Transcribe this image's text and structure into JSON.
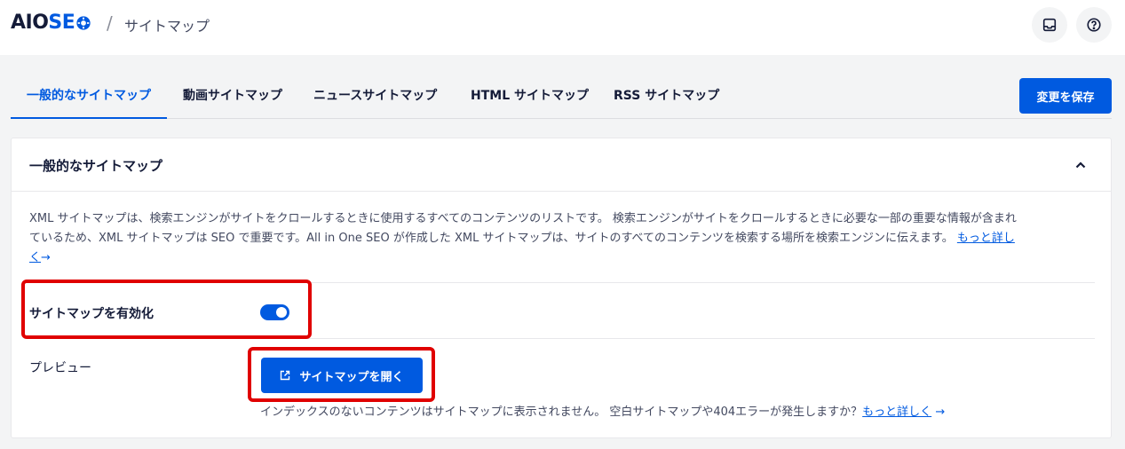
{
  "header": {
    "logo_aio": "AIO",
    "logo_seo": "SE",
    "separator": "/",
    "page_title": "サイトマップ"
  },
  "tabs": [
    {
      "label": "一般的なサイトマップ",
      "active": true
    },
    {
      "label": "動画サイトマップ",
      "active": false
    },
    {
      "label": "ニュースサイトマップ",
      "active": false
    },
    {
      "label": "HTML サイトマップ",
      "active": false
    },
    {
      "label": "RSS サイトマップ",
      "active": false
    }
  ],
  "save_button": "変更を保存",
  "card": {
    "title": "一般的なサイトマップ",
    "description_line1": "XML サイトマップは、検索エンジンがサイトをクロールするときに使用するすべてのコンテンツのリストです。 検索エンジンがサイトをクロールするときに必要な一部の重要な情報が含まれ",
    "description_line2": "ているため、XML サイトマップは SEO で重要です。All in One SEO が作成した XML サイトマップは、サイトのすべてのコンテンツを検索する場所を検索エンジンに伝えます。",
    "learn_more_a": "もっと詳し",
    "learn_more_b": "く",
    "arrow": "→",
    "enable_label": "サイトマップを有効化",
    "enable_on": true,
    "preview_label": "プレビュー",
    "open_button": "サイトマップを開く",
    "note_text": "インデックスのないコンテンツはサイトマップに表示されません。 空白サイトマップや404エラーが発生しますか？",
    "note_link": "もっと詳しく",
    "note_arrow": "→"
  },
  "colors": {
    "accent": "#005ae0",
    "highlight": "#e00000"
  }
}
